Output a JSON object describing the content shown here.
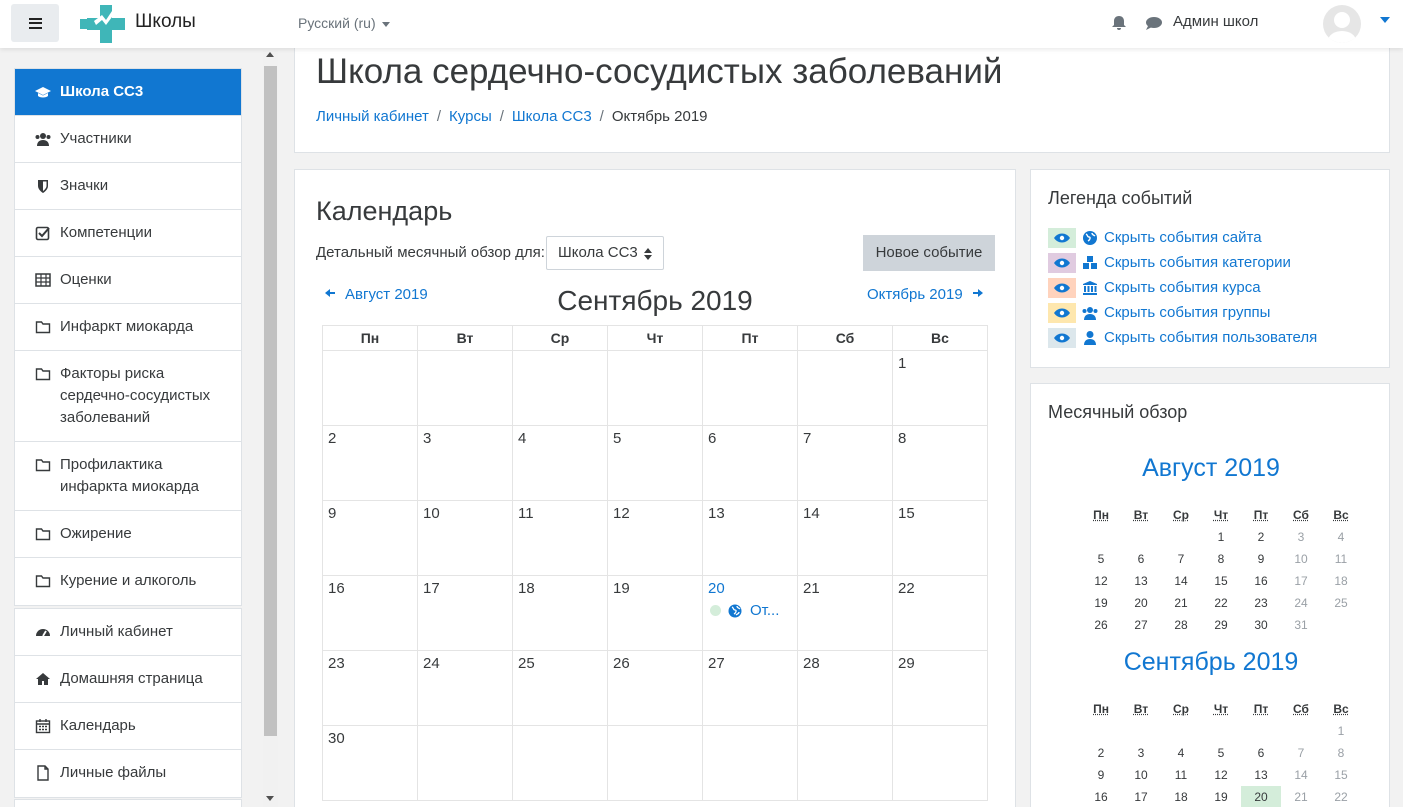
{
  "navbar": {
    "site_name": "Школы",
    "language": "Русский ‎(ru)‎",
    "user_name": "Админ школ"
  },
  "drawer": {
    "course_items": [
      {
        "label": "Школа СС3",
        "icon": "graduation-cap-icon",
        "active": true
      },
      {
        "label": "Участники",
        "icon": "users-icon"
      },
      {
        "label": "Значки",
        "icon": "shield-icon"
      },
      {
        "label": "Компетенции",
        "icon": "check-square-icon"
      },
      {
        "label": "Оценки",
        "icon": "table-icon"
      },
      {
        "label": "Инфаркт миокарда",
        "icon": "folder-icon"
      },
      {
        "label": "Факторы риска сердечно-сосудистых заболеваний",
        "icon": "folder-icon"
      },
      {
        "label": "Профилактика инфаркта миокарда",
        "icon": "folder-icon"
      },
      {
        "label": "Ожирение",
        "icon": "folder-icon"
      },
      {
        "label": "Курение и алкоголь",
        "icon": "folder-icon"
      }
    ],
    "site_items": [
      {
        "label": "Личный кабинет",
        "icon": "dashboard-icon"
      },
      {
        "label": "Домашняя страница",
        "icon": "home-icon"
      },
      {
        "label": "Календарь",
        "icon": "calendar-icon"
      },
      {
        "label": "Личные файлы",
        "icon": "file-icon"
      }
    ]
  },
  "header": {
    "title": "Школа сердечно-сосудистых заболеваний",
    "breadcrumb": [
      "Личный кабинет",
      "Курсы",
      "Школа СС3",
      "Октябрь 2019"
    ]
  },
  "calendar": {
    "title": "Календарь",
    "filter_label": "Детальный месячный обзор для:",
    "filter_value": "Школа СС3",
    "new_event_label": "Новое событие",
    "prev_month": "Август 2019",
    "next_month": "Октябрь 2019",
    "current_month": "Сентябрь 2019",
    "weekdays": [
      "Пн",
      "Вт",
      "Ср",
      "Чт",
      "Пт",
      "Сб",
      "Вс"
    ],
    "weeks": [
      [
        "",
        "",
        "",
        "",
        "",
        "",
        "1"
      ],
      [
        "2",
        "3",
        "4",
        "5",
        "6",
        "7",
        "8"
      ],
      [
        "9",
        "10",
        "11",
        "12",
        "13",
        "14",
        "15"
      ],
      [
        "16",
        "17",
        "18",
        "19",
        "20",
        "21",
        "22"
      ],
      [
        "23",
        "24",
        "25",
        "26",
        "27",
        "28",
        "29"
      ],
      [
        "30",
        "",
        "",
        "",
        "",
        "",
        ""
      ]
    ],
    "today": "20",
    "event_label": "От..."
  },
  "legend": {
    "title": "Легенда событий",
    "items": [
      {
        "label": "Скрыть события сайта",
        "icon": "globe-icon",
        "color": "#d4edda"
      },
      {
        "label": "Скрыть события категории",
        "icon": "cubes-icon",
        "color": "#e0cbe0"
      },
      {
        "label": "Скрыть события курса",
        "icon": "university-icon",
        "color": "#ffd3bd"
      },
      {
        "label": "Скрыть события группы",
        "icon": "users-icon",
        "color": "#fee7ae"
      },
      {
        "label": "Скрыть события пользователя",
        "icon": "user-icon",
        "color": "#dce7ec"
      }
    ]
  },
  "monthly": {
    "title": "Месячный обзор",
    "weekdays": [
      "Пн",
      "Вт",
      "Ср",
      "Чт",
      "Пт",
      "Сб",
      "Вс"
    ],
    "months": [
      {
        "name": "Август 2019",
        "weeks": [
          [
            "",
            "",
            "",
            "1",
            "2",
            "3",
            "4"
          ],
          [
            "5",
            "6",
            "7",
            "8",
            "9",
            "10",
            "11"
          ],
          [
            "12",
            "13",
            "14",
            "15",
            "16",
            "17",
            "18"
          ],
          [
            "19",
            "20",
            "21",
            "22",
            "23",
            "24",
            "25"
          ],
          [
            "26",
            "27",
            "28",
            "29",
            "30",
            "31",
            ""
          ]
        ]
      },
      {
        "name": "Сентябрь 2019",
        "weeks": [
          [
            "",
            "",
            "",
            "",
            "",
            "",
            "1"
          ],
          [
            "2",
            "3",
            "4",
            "5",
            "6",
            "7",
            "8"
          ],
          [
            "9",
            "10",
            "11",
            "12",
            "13",
            "14",
            "15"
          ],
          [
            "16",
            "17",
            "18",
            "19",
            "20",
            "21",
            "22"
          ]
        ],
        "today": "20"
      }
    ]
  },
  "colors": {
    "accent": "#1177d1",
    "today_bg": "#d4edda",
    "button_bg": "#ced4da"
  }
}
